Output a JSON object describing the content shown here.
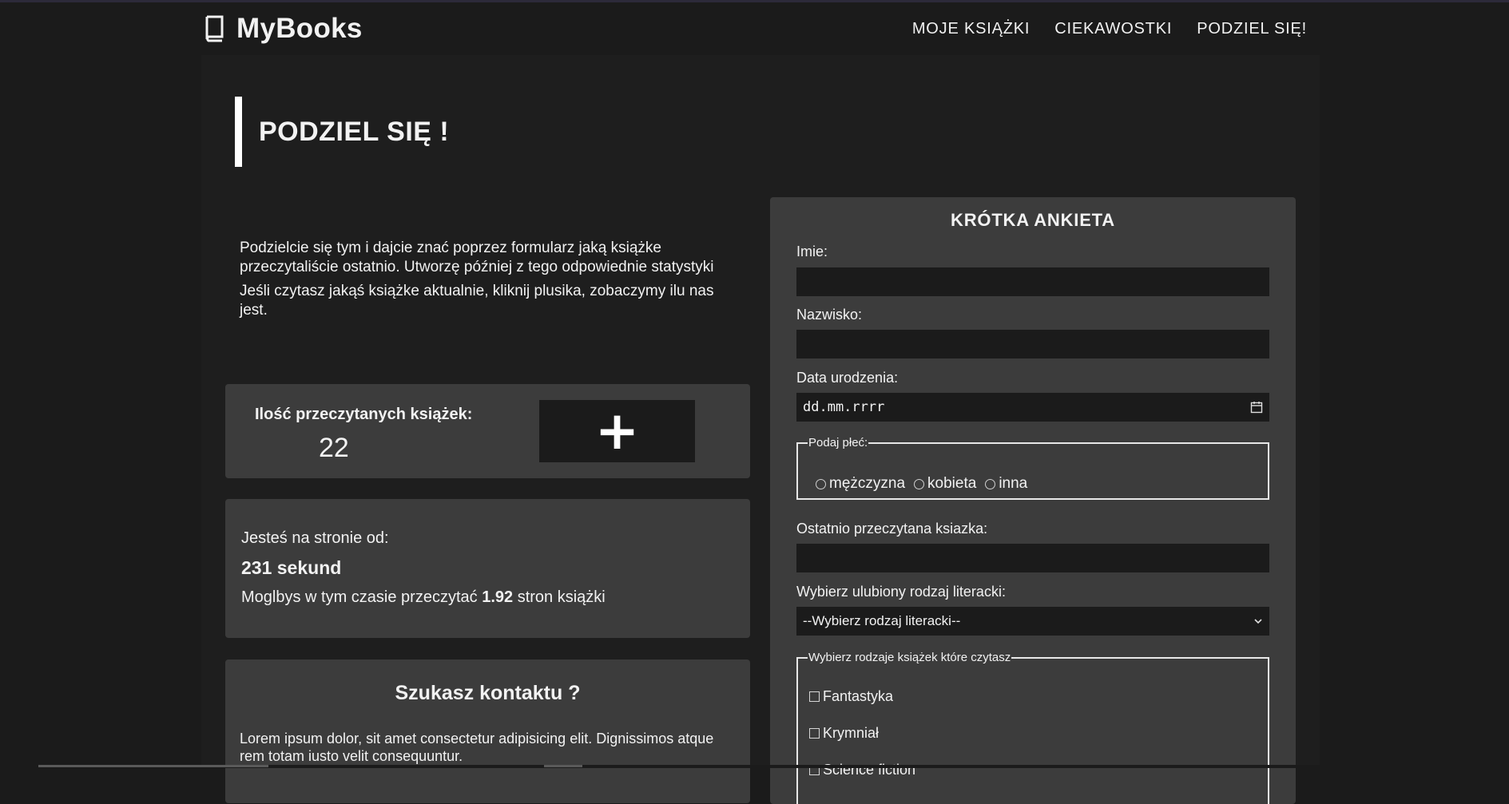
{
  "header": {
    "brand": "MyBooks",
    "nav": [
      "MOJE KSIĄŻKI",
      "CIEKAWOSTKI",
      "PODZIEL SIĘ!"
    ]
  },
  "page": {
    "title": "PODZIEL SIĘ !",
    "intro_p1": "Podzielcie się tym i dajcie znać poprzez formularz jaką książke przeczytaliście ostatnio. Utworzę później z tego odpowiednie statystyki",
    "intro_p2": "Jeśli czytasz jakąś książke aktualnie, kliknij plusika, zobaczymy ilu nas jest."
  },
  "counter": {
    "label": "Ilość przeczytanych książek:",
    "value": "22",
    "button_label": "+"
  },
  "time": {
    "label": "Jesteś na stronie od:",
    "value": "231 sekund",
    "note_before": "Moglbys w tym czasie przeczytać",
    "note_value": "1.92",
    "note_after": "stron książki"
  },
  "contact": {
    "title": "Szukasz kontaktu ?",
    "text": "Lorem ipsum dolor, sit amet consectetur adipisicing elit. Dignissimos atque rem totam iusto velit consequuntur."
  },
  "survey": {
    "title": "KRÓTKA ANKIETA",
    "first_name_label": "Imie:",
    "last_name_label": "Nazwisko:",
    "birth_label": "Data urodzenia:",
    "birth_placeholder": "dd.mm.rrrr",
    "gender_legend": "Podaj płeć:",
    "gender_options": [
      "mężczyzna",
      "kobieta",
      "inna"
    ],
    "last_book_label": "Ostatnio przeczytana ksiazka:",
    "genre_label": "Wybierz ulubiony rodzaj literacki:",
    "genre_selected": "--Wybierz rodzaj literacki--",
    "types_legend": "Wybierz rodzaje książek które czytasz",
    "types": [
      "Fantastyka",
      "Krymniał",
      "Science fiction"
    ]
  }
}
